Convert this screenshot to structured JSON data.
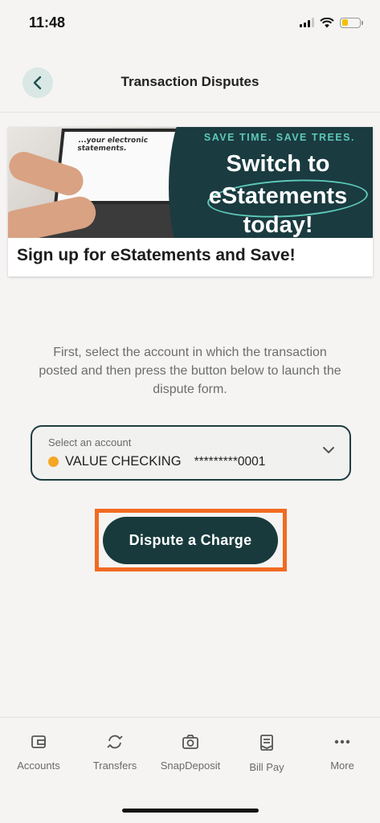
{
  "status_bar": {
    "time": "11:48"
  },
  "header": {
    "title": "Transaction Disputes"
  },
  "banner": {
    "tagline": "SAVE TIME. SAVE TREES.",
    "line1": "Switch to",
    "line2": "eStatements",
    "line3": "today!",
    "screen_text": "...your electronic statements.",
    "caption": "Sign up for eStatements and Save!"
  },
  "instructions": "First, select the account in which the transaction posted and then press the button below to launch the dispute form.",
  "account_select": {
    "label": "Select an account",
    "account_name": "VALUE CHECKING",
    "account_number": "*********0001",
    "status_color": "#f5a623"
  },
  "dispute_button": {
    "label": "Dispute a Charge"
  },
  "colors": {
    "primary": "#183a3d",
    "accent": "#5ec8b8",
    "highlight": "#f26a21"
  },
  "bottom_nav": {
    "items": [
      {
        "label": "Accounts",
        "icon": "wallet-icon"
      },
      {
        "label": "Transfers",
        "icon": "transfer-arrows-icon"
      },
      {
        "label": "SnapDeposit",
        "icon": "camera-icon"
      },
      {
        "label": "Bill Pay",
        "icon": "bill-icon"
      },
      {
        "label": "More",
        "icon": "more-dots-icon"
      }
    ]
  }
}
